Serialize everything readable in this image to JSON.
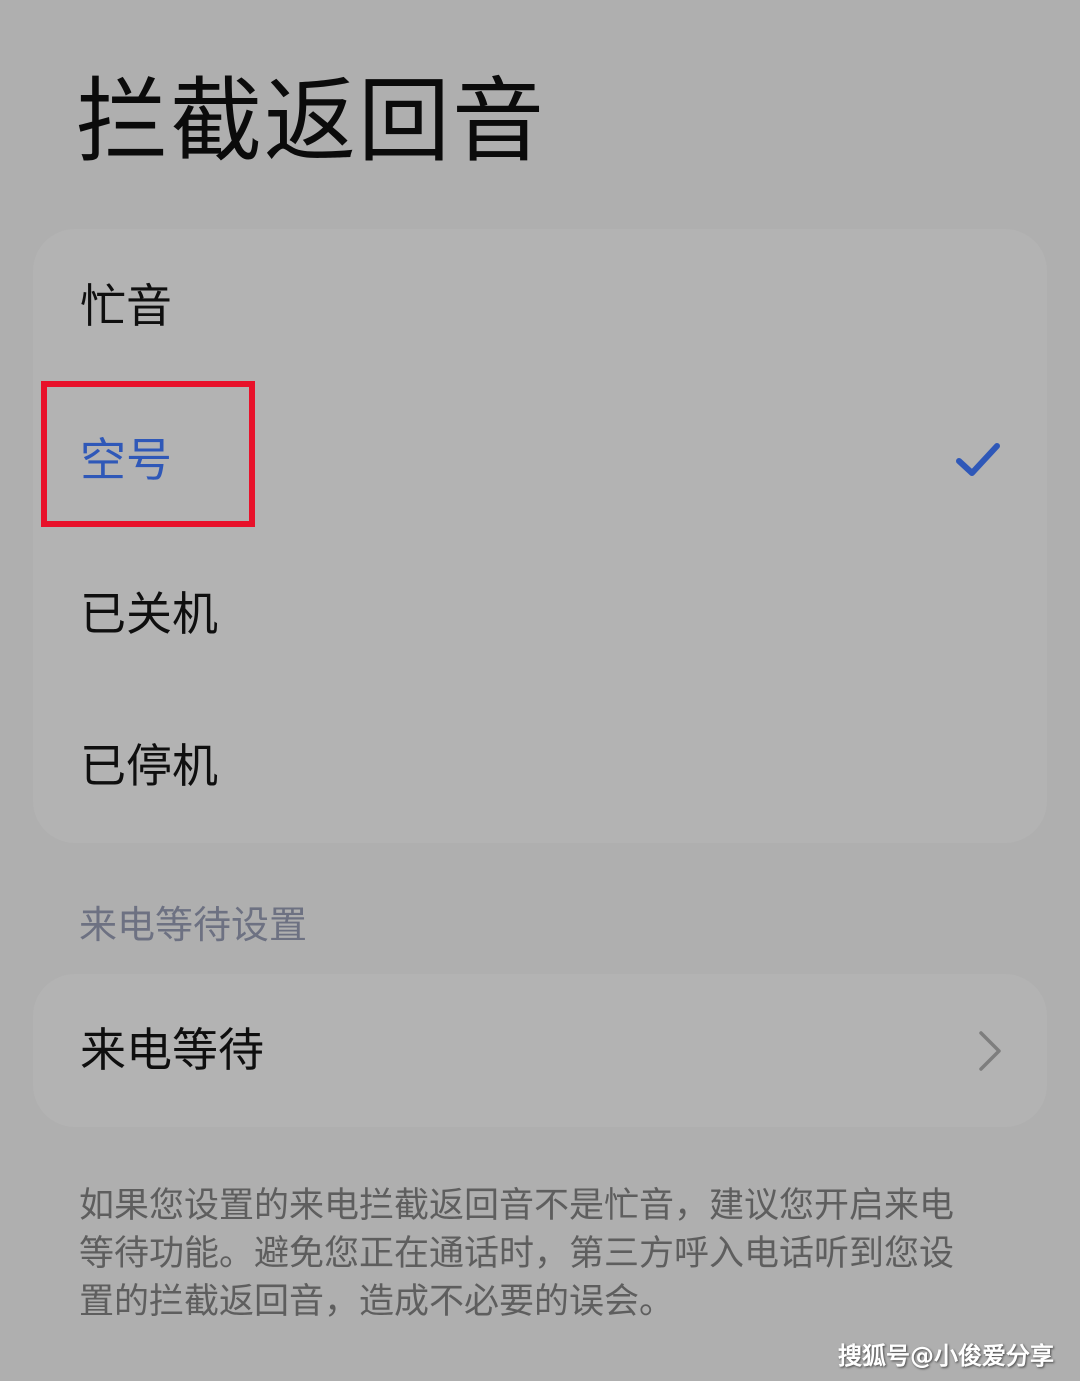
{
  "page": {
    "title": "拦截返回音"
  },
  "options": {
    "items": [
      {
        "label": "忙音",
        "selected": false
      },
      {
        "label": "空号",
        "selected": true
      },
      {
        "label": "已关机",
        "selected": false
      },
      {
        "label": "已停机",
        "selected": false
      }
    ]
  },
  "call_waiting_section": {
    "header": "来电等待设置",
    "item_label": "来电等待",
    "item_icon": "chevron-right-icon"
  },
  "footnote": {
    "lines": [
      "如果您设置的来电拦截返回音不是忙音，建议您开启来电",
      "等待功能。避免您正在通话时，第三方呼入电话听到您设",
      "置的拦截返回音，造成不必要的误会。"
    ]
  },
  "watermark": "搜狐号@小俊爱分享",
  "colors": {
    "background": "#afafaf",
    "card": "#b3b3b3",
    "accent_blue": "#2f58b8",
    "highlight_red": "#e8112a",
    "section_header": "#6d7182"
  },
  "icons": {
    "selected_marker": "checkmark-icon",
    "row_arrow": "chevron-right-icon"
  }
}
